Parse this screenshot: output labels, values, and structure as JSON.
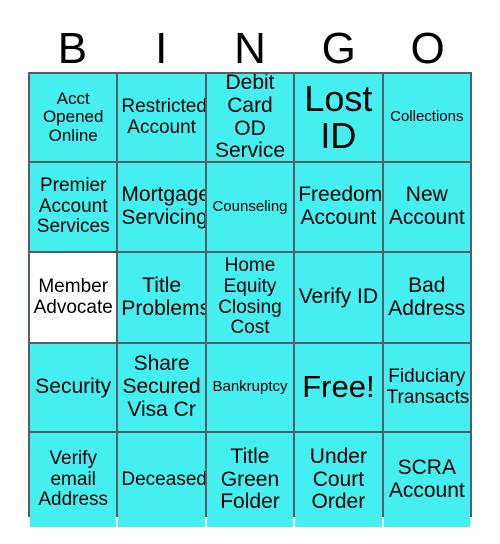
{
  "card": {
    "title_letters": [
      "B",
      "I",
      "N",
      "G",
      "O"
    ],
    "colors": {
      "marked": "#45EFEF",
      "unmarked": "#FFFFFF",
      "grid_line": "#555F63",
      "text": "#000000"
    },
    "rows": [
      [
        {
          "label": "Acct Opened Online",
          "marked": true,
          "size": "s"
        },
        {
          "label": "Restricted Account",
          "marked": true,
          "size": "m"
        },
        {
          "label": "Debit Card OD Service",
          "marked": true,
          "size": "l"
        },
        {
          "label": "Lost ID",
          "marked": true,
          "size": "xxl"
        },
        {
          "label": "Collections",
          "marked": true,
          "size": "xs"
        }
      ],
      [
        {
          "label": "Premier Account Services",
          "marked": true,
          "size": "m"
        },
        {
          "label": "Mortgage Servicing",
          "marked": true,
          "size": "l"
        },
        {
          "label": "Counseling",
          "marked": true,
          "size": "xs"
        },
        {
          "label": "Freedom Account",
          "marked": true,
          "size": "l"
        },
        {
          "label": "New Account",
          "marked": true,
          "size": "l"
        }
      ],
      [
        {
          "label": "Member Advocate",
          "marked": false,
          "size": "m"
        },
        {
          "label": "Title Problems",
          "marked": true,
          "size": "l"
        },
        {
          "label": "Home Equity Closing Cost",
          "marked": true,
          "size": "m"
        },
        {
          "label": "Verify ID",
          "marked": true,
          "size": "l"
        },
        {
          "label": "Bad Address",
          "marked": true,
          "size": "l"
        }
      ],
      [
        {
          "label": "Security",
          "marked": true,
          "size": "l"
        },
        {
          "label": "Share Secured Visa Cr",
          "marked": true,
          "size": "l"
        },
        {
          "label": "Bankruptcy",
          "marked": true,
          "size": "xs"
        },
        {
          "label": "Free!",
          "marked": true,
          "size": "xl"
        },
        {
          "label": "Fiduciary Transacts",
          "marked": true,
          "size": "m"
        }
      ],
      [
        {
          "label": "Verify email Address",
          "marked": true,
          "size": "m"
        },
        {
          "label": "Deceased",
          "marked": true,
          "size": "m"
        },
        {
          "label": "Title Green Folder",
          "marked": true,
          "size": "l"
        },
        {
          "label": "Under Court Order",
          "marked": true,
          "size": "l"
        },
        {
          "label": "SCRA Account",
          "marked": true,
          "size": "l"
        }
      ]
    ]
  }
}
